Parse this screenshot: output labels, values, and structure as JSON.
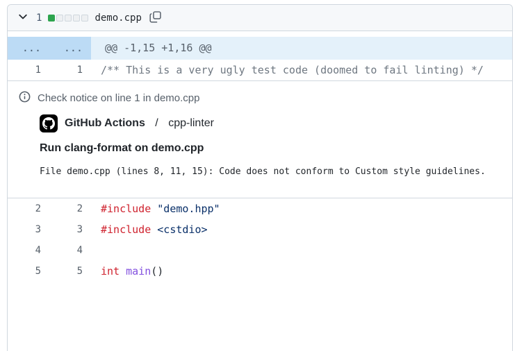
{
  "file_header": {
    "changes_count": "1",
    "filename": "demo.cpp",
    "diffstat_blocks": [
      "added",
      "neutral",
      "neutral",
      "neutral",
      "neutral"
    ]
  },
  "diff": {
    "hunk": {
      "old_marker": "...",
      "new_marker": "...",
      "text": "@@ -1,15 +1,16 @@"
    },
    "rows_before": [
      {
        "old": "1",
        "new": "1",
        "tokens": [
          {
            "text": "/** This is a very ugly test code (doomed to fail linting) */",
            "type": "comment"
          }
        ]
      }
    ],
    "rows_after": [
      {
        "old": "2",
        "new": "2",
        "tokens": [
          {
            "text": "#include",
            "type": "keyword"
          },
          {
            "text": " ",
            "type": "plain"
          },
          {
            "text": "\"demo.hpp\"",
            "type": "string"
          }
        ]
      },
      {
        "old": "3",
        "new": "3",
        "tokens": [
          {
            "text": "#include",
            "type": "keyword"
          },
          {
            "text": " ",
            "type": "plain"
          },
          {
            "text": "<cstdio>",
            "type": "string"
          }
        ]
      },
      {
        "old": "4",
        "new": "4",
        "tokens": []
      },
      {
        "old": "5",
        "new": "5",
        "tokens": [
          {
            "text": "int",
            "type": "keyword"
          },
          {
            "text": " ",
            "type": "plain"
          },
          {
            "text": "main",
            "type": "entity"
          },
          {
            "text": "()",
            "type": "plain"
          }
        ]
      }
    ]
  },
  "annotation": {
    "notice_label": "Check notice on line 1 in demo.cpp",
    "app_name": "GitHub Actions",
    "separator": " / ",
    "check_name": "cpp-linter",
    "title": "Run clang-format on demo.cpp",
    "message": "File demo.cpp (lines 8, 11, 15): Code does not conform to Custom style guidelines."
  },
  "colors": {
    "header_bg": "#f6f8fa",
    "border": "#d0d7de",
    "added_block": "#2da44e",
    "hunk_gutter_bg": "#bcdbf5",
    "hunk_body_bg": "#e4f1fa",
    "keyword": "#cf222e",
    "string": "#0a3069",
    "entity": "#8250df",
    "comment": "#6e7781"
  }
}
